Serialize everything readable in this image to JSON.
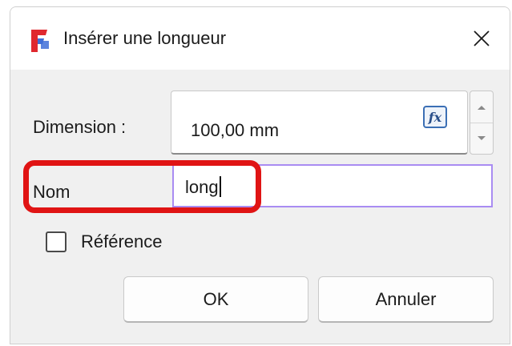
{
  "window": {
    "title": "Insérer une longueur",
    "app_icon": "freecad-logo-icon",
    "close_icon": "close-icon"
  },
  "dimension": {
    "label": "Dimension :",
    "value": "100,00 mm",
    "expression_icon": "fx-expression-icon",
    "spin_up_icon": "spin-up-icon",
    "spin_down_icon": "spin-down-icon"
  },
  "name": {
    "label": "Nom",
    "value": "long"
  },
  "reference": {
    "label": "Référence",
    "checked": false
  },
  "buttons": {
    "ok": "OK",
    "cancel": "Annuler"
  },
  "colors": {
    "highlight": "#e01414",
    "focus_border": "#a98cf2",
    "app_icon_red": "#e0282e",
    "app_icon_blue": "#3f6fd8"
  }
}
